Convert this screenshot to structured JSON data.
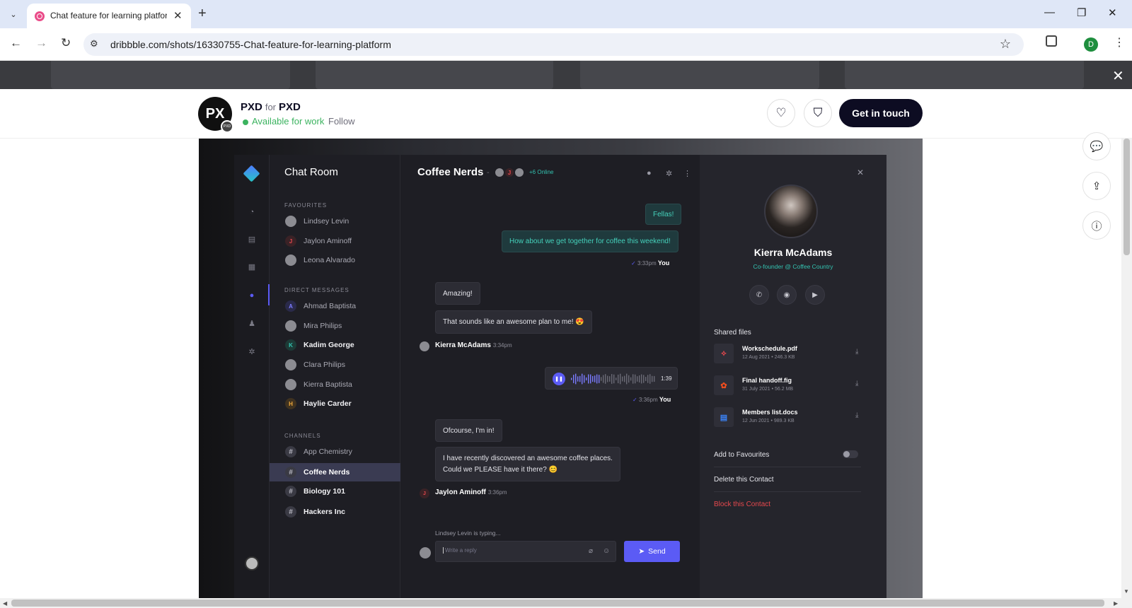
{
  "browser": {
    "tab_title": "Chat feature for learning platform",
    "url": "dribbble.com/shots/16330755-Chat-feature-for-learning-platform",
    "profile_initial": "D"
  },
  "shot_header": {
    "team_logo_text": "PX",
    "team_badge_text": "PXD",
    "designer_name": "PXD",
    "for_label": "for",
    "team_name": "PXD",
    "availability": "Available for work",
    "follow_label": "Follow",
    "cta_label": "Get in touch"
  },
  "app": {
    "list_title": "Chat Room",
    "sections": {
      "favourites": "FAVOURITES",
      "direct": "DIRECT MESSAGES",
      "channels": "CHANNELS"
    },
    "favourites": [
      {
        "name": "Lindsey Levin",
        "avatar": ""
      },
      {
        "name": "Jaylon Aminoff",
        "avatar": "J"
      },
      {
        "name": "Leona Alvarado",
        "avatar": ""
      }
    ],
    "direct_messages": [
      {
        "name": "Ahmad Baptista",
        "avatar": "A"
      },
      {
        "name": "Mira Philips",
        "avatar": ""
      },
      {
        "name": "Kadim George",
        "avatar": "K"
      },
      {
        "name": "Clara Philips",
        "avatar": ""
      },
      {
        "name": "Kierra Baptista",
        "avatar": ""
      },
      {
        "name": "Haylie Carder",
        "avatar": "H"
      }
    ],
    "channels": [
      {
        "name": "App Chemistry",
        "avatar": "#"
      },
      {
        "name": "Coffee Nerds",
        "avatar": "#"
      },
      {
        "name": "Biology 101",
        "avatar": "#"
      },
      {
        "name": "Hackers Inc",
        "avatar": "#"
      }
    ],
    "chat": {
      "title": "Coffee Nerds",
      "separator": "-",
      "member_initial": "J",
      "online": "+6 Online",
      "messages": {
        "m1": "Fellas!",
        "m2": "How about we get together for coffee this weekend!",
        "m2_time": "3:33pm",
        "you": "You",
        "m3": "Amazing!",
        "m4": "That sounds like an awesome plan to me! 😍",
        "sender1": "Kierra McAdams",
        "sender1_time": "3:34pm",
        "voice_duration": "1:39",
        "voice_time": "3:36pm",
        "m5": "Ofcourse, I'm in!",
        "m6_line1": "I have recently discovered an awesome coffee places.",
        "m6_line2": "Could we PLEASE have it there? 😊",
        "sender2_initial": "J",
        "sender2": "Jaylon Aminoff",
        "sender2_time": "3:36pm"
      },
      "typing": "Lindsey Levin is typing...",
      "reply_placeholder": "Write a reply",
      "send_label": "Send"
    },
    "profile": {
      "name": "Kierra McAdams",
      "role": "Co-founder @ Coffee Country",
      "shared_files_title": "Shared files",
      "files": [
        {
          "name": "Workschedule.pdf",
          "meta": "12 Aug 2021  •  246.3 KB",
          "icon": "pdf-icon"
        },
        {
          "name": "Final handoff.fig",
          "meta": "31 July 2021  •  56.2 MB",
          "icon": "figma-icon"
        },
        {
          "name": "Members list.docs",
          "meta": "12 Jun 2021  •  989.3 KB",
          "icon": "docs-icon"
        }
      ],
      "add_to_favourites": "Add to Favourites",
      "delete_contact": "Delete this Contact",
      "block_contact": "Block this Contact"
    }
  },
  "colors": {
    "accent": "#5b5bf5",
    "teal": "#33c3b1",
    "available": "#3bb35f",
    "danger": "#e5484d",
    "cta": "#0d0c22"
  }
}
